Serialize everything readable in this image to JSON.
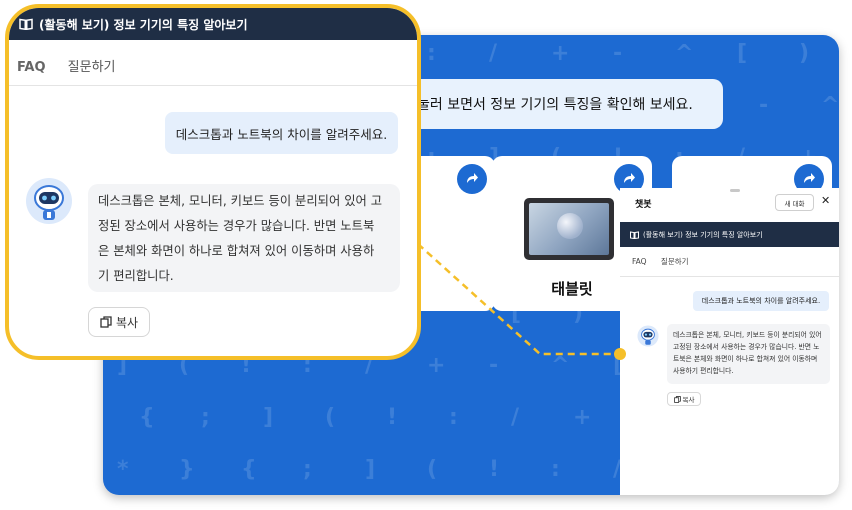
{
  "page": {
    "instruction": "눌러 보면서 정보 기기의 특징을 확인해 보세요.",
    "cards": [
      {
        "label": ""
      },
      {
        "label": "태블릿"
      },
      {
        "label": ""
      }
    ],
    "background_symbols": [
      "{",
      ";",
      "]",
      "(",
      "!",
      ":",
      "/",
      "+",
      "-",
      "^",
      "[",
      ")",
      "*",
      "}"
    ]
  },
  "chatbot": {
    "title": "챗봇",
    "new_chat_label": "새 대화",
    "close_icon": "close-icon",
    "topic": "(활동해 보기) 정보 기기의 특징 알아보기",
    "tabs": [
      "FAQ",
      "질문하기"
    ],
    "user_message": "데스크톱과 노트북의 차이를 알려주세요.",
    "bot_message": "데스크톱은 본체, 모니터, 키보드 등이 분리되어 있어 고정된 장소에서 사용하는 경우가 많습니다. 반면 노트북은 본체와 화면이 하나로 합쳐져 있어 이동하며 사용하기 편리합니다.",
    "copy_label": "복사"
  },
  "callout": {
    "topic": "(활동해 보기) 정보 기기의 특징 알아보기",
    "tabs": [
      "FAQ",
      "질문하기"
    ],
    "user_message": "데스크톱과 노트북의 차이를 알려주세요.",
    "bot_lines": [
      "데스크톱은 본체, 모니터, 키보드 등이 분리되어 있어 고",
      "정된 장소에서 사용하는 경우가 많습니다. 반면 노트북",
      "은 본체와 화면이 하나로 합쳐져 있어 이동하며 사용하",
      "기 편리합니다."
    ],
    "copy_label": "복사"
  },
  "colors": {
    "page_blue": "#1d6ad2",
    "navy_bar": "#1f2e45",
    "callout_border": "#f5bf29",
    "user_bubble": "#e5effc",
    "bot_bubble": "#f3f4f6"
  }
}
